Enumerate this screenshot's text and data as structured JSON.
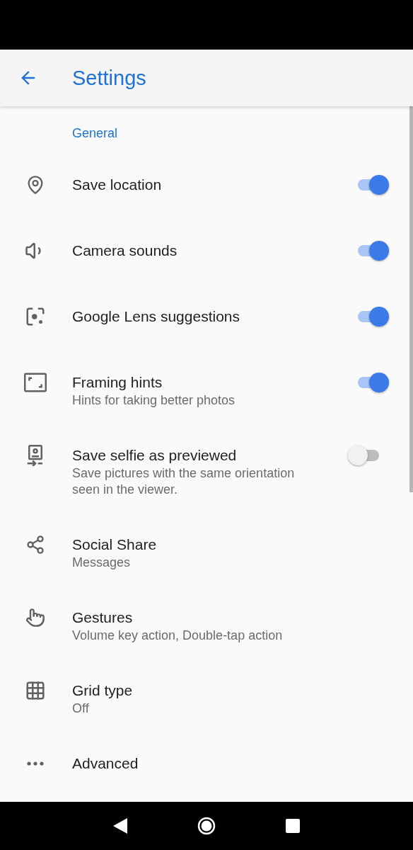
{
  "app_bar": {
    "title": "Settings"
  },
  "section": {
    "title": "General"
  },
  "rows": [
    {
      "kind": "switch",
      "title": "Save location",
      "on": true
    },
    {
      "kind": "switch",
      "title": "Camera sounds",
      "on": true
    },
    {
      "kind": "switch",
      "title": "Google Lens suggestions",
      "on": true
    },
    {
      "kind": "switch",
      "title": "Framing hints",
      "subtitle": "Hints for taking better photos",
      "on": true
    },
    {
      "kind": "switch",
      "title": "Save selfie as previewed",
      "subtitle": "Save pictures with the same orientation seen in the viewer.",
      "on": false
    },
    {
      "kind": "link",
      "title": "Social Share",
      "subtitle": "Messages"
    },
    {
      "kind": "link",
      "title": "Gestures",
      "subtitle": "Volume key action, Double-tap action"
    },
    {
      "kind": "link",
      "title": "Grid type",
      "subtitle": "Off"
    },
    {
      "kind": "link",
      "title": "Advanced"
    }
  ]
}
